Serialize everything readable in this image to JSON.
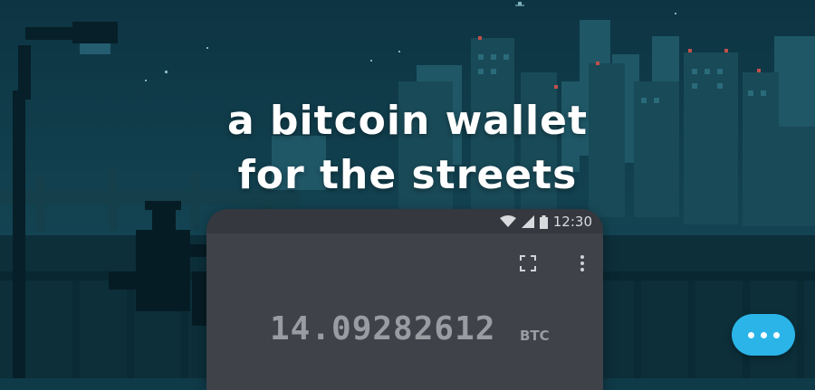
{
  "hero": {
    "headline_line1": "a bitcoin wallet",
    "headline_line2": "for the streets"
  },
  "phone": {
    "status_time": "12:30",
    "status_icons": [
      "wifi-icon",
      "cell-signal-icon",
      "battery-icon"
    ],
    "toolbar_icons": [
      "fullscreen-icon",
      "more-vert-icon"
    ],
    "balance": "14.09282612",
    "unit": "BTC"
  },
  "chat": {
    "icon": "chat-ellipsis-icon",
    "color": "#2ab4e8"
  },
  "colors": {
    "sky": "#0f3a48",
    "phone_body": "#3f4249",
    "text": "#ffffff"
  }
}
